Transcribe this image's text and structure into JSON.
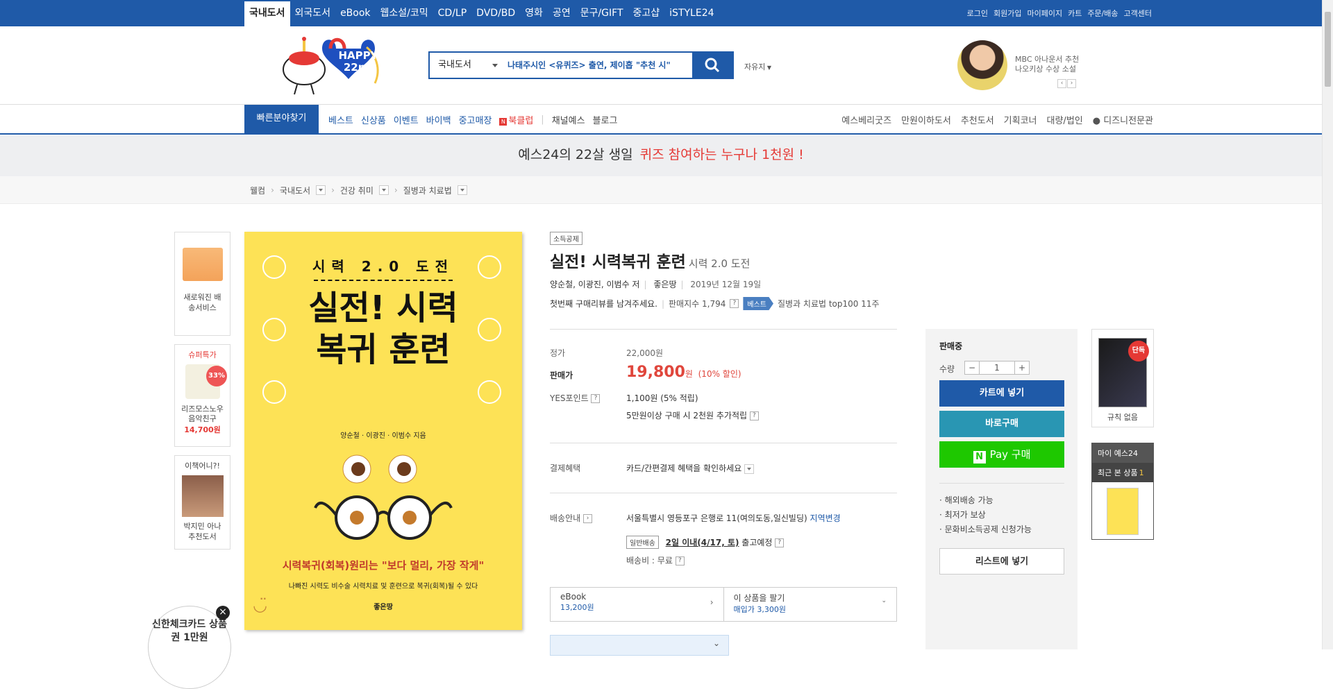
{
  "topbar": {
    "tabs": [
      "국내도서",
      "외국도서",
      "eBook",
      "웹소설/코믹",
      "CD/LP",
      "DVD/BD",
      "영화",
      "공연",
      "문구/GIFT",
      "중고샵",
      "iSTYLE24"
    ],
    "util": [
      "로그인",
      "회원가입",
      "마이페이지",
      "카트",
      "주문/배송",
      "고객센터"
    ]
  },
  "header": {
    "logo_text": "HAPPY 22nd",
    "search_category": "국내도서",
    "search_keyword": "나태주시인 <유퀴즈> 출연, 제이홉 \"추천 시\"",
    "account_label": "자유지",
    "promo_line1": "MBC 아나운서 추천",
    "promo_line2": "나오키상 수상 소설"
  },
  "nav": {
    "quick": "빠른분야찾기",
    "left": [
      "베스트",
      "신상품",
      "이벤트",
      "바이백",
      "중고매장",
      "북클럽",
      "채널예스",
      "블로그"
    ],
    "right": [
      "예스베리굿즈",
      "만원이하도서",
      "추천도서",
      "기획코너",
      "대량/법인",
      "디즈니전문관"
    ]
  },
  "banner": {
    "text": "예스24의 22살 생일",
    "highlight": "퀴즈 참여하는 누구나 1천원 !"
  },
  "breadcrumb": [
    "웰컴",
    "국내도서",
    "건강 취미",
    "질병과 치료법"
  ],
  "sidebar": {
    "box1_label": "새로워진 배송서비스",
    "box2_title": "슈퍼특가",
    "box2_discount": "33%",
    "box2_name": "리즈모스노우 음악친구",
    "box2_price": "14,700원",
    "box3_title": "이책어니?!",
    "box3_name": "박지민 아나 추천도서"
  },
  "cover": {
    "top": "시력 2.0 도전",
    "main": "실전! 시력복귀 훈련",
    "authors": "양순철 · 이광진 · 이범수 지음",
    "slogan": "시력복귀(회복)원리는 \"보다 멀리, 가장 작게\"",
    "sub": "나빠진 시력도 비수술 시력치료 및 훈련으로 복귀(회복)될 수 있다",
    "publisher": "좋은땅"
  },
  "product": {
    "badge": "소득공제",
    "title": "실전! 시력복귀 훈련",
    "subtitle": "시력 2.0 도전",
    "authors": "양순철, 이광진, 이범수 저",
    "publisher": "좋은땅",
    "date": "2019년 12월 19일",
    "review_prompt": "첫번째 구매리뷰를 남겨주세요.",
    "sales_index": "판매지수 1,794",
    "best_tag": "베스트",
    "best_rank": "질병과 치료법 top100 11주",
    "list_price_label": "정가",
    "list_price": "22,000원",
    "sale_price_label": "판매가",
    "sale_price": "19,800",
    "sale_unit": "원",
    "discount": "(10% 할인)",
    "points_label": "YES포인트",
    "points": "1,100원 (5% 적립)",
    "points_extra": "5만원이상 구매 시 2천원 추가적립",
    "benefit_label": "결제혜택",
    "benefit": "카드/간편결제 혜택을 확인하세요",
    "ship_label": "배송안내",
    "address": "서울특별시 영등포구 은행로 11(여의도동,일신빌딩)",
    "change_region": "지역변경",
    "ship_type": "일반배송",
    "ship_date": "2일 이내(4/17, 토)",
    "ship_suffix": "출고예정",
    "ship_fee": "배송비 : 무료",
    "ebook_label": "eBook",
    "ebook_price": "13,200원",
    "sell_label": "이 상품을 팔기",
    "sell_price": "매입가 3,300원"
  },
  "buy": {
    "status": "판매중",
    "qty_label": "수량",
    "qty": "1",
    "cart": "카트에 넣기",
    "buy_now": "바로구매",
    "npay": "Pay 구매",
    "features": [
      "해외배송 가능",
      "최저가 보상",
      "문화비소득공제 신청가능"
    ],
    "wishlist": "리스트에 넣기",
    "colors": {
      "cart": "#1f5aa8",
      "buy_now": "#2996b3",
      "npay": "#1ec800"
    }
  },
  "right": {
    "exclusive": "단독",
    "caption": "규칙 없음",
    "my_yes": "마이 예스24",
    "recent": "최근 본 상품",
    "recent_count": "1"
  },
  "floating": {
    "text": "신한체크카드 상품권 1만원"
  }
}
